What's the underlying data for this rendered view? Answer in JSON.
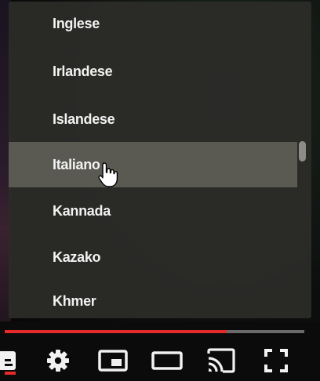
{
  "language_menu": {
    "items": [
      {
        "label": "Inglese"
      },
      {
        "label": "Irlandese"
      },
      {
        "label": "Islandese"
      },
      {
        "label": "Italiano"
      },
      {
        "label": "Kannada"
      },
      {
        "label": "Kazako"
      },
      {
        "label": "Khmer"
      }
    ],
    "selected_label": "Italiano"
  },
  "player": {
    "progress_fraction": 0.74,
    "progress_color": "#e52a2a",
    "controls": [
      {
        "icon": "subtitles-icon",
        "active": true
      },
      {
        "icon": "gear-icon"
      },
      {
        "icon": "miniplayer-icon"
      },
      {
        "icon": "theater-mode-icon"
      },
      {
        "icon": "cast-icon"
      },
      {
        "icon": "fullscreen-icon"
      }
    ]
  }
}
